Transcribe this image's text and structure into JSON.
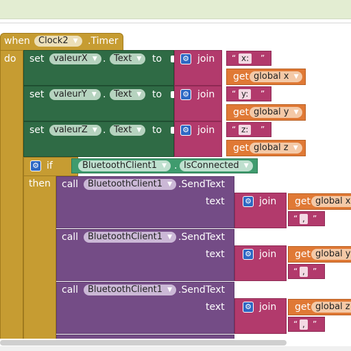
{
  "event": {
    "when": "when",
    "component": "Clock2",
    "event_name": ".Timer",
    "do": "do"
  },
  "sets": [
    {
      "set": "set",
      "component": "valeurX",
      "property": "Text",
      "to": "to",
      "join": "join",
      "text": "x:",
      "get": "get",
      "variable": "global x"
    },
    {
      "set": "set",
      "component": "valeurY",
      "property": "Text",
      "to": "to",
      "join": "join",
      "text": "y:",
      "get": "get",
      "variable": "global y"
    },
    {
      "set": "set",
      "component": "valeurZ",
      "property": "Text",
      "to": "to",
      "join": "join",
      "text": "z:",
      "get": "get",
      "variable": "global z"
    }
  ],
  "if_block": {
    "if": "if",
    "then": "then",
    "component": "BluetoothClient1",
    "property": "IsConnected"
  },
  "calls": [
    {
      "call": "call",
      "component": "BluetoothClient1",
      "method": ".SendText",
      "text_label": "text",
      "join": "join",
      "get": "get",
      "variable": "global x",
      "string": ","
    },
    {
      "call": "call",
      "component": "BluetoothClient1",
      "method": ".SendText",
      "text_label": "text",
      "join": "join",
      "get": "get",
      "variable": "global y",
      "string": ","
    },
    {
      "call": "call",
      "component": "BluetoothClient1",
      "method": ".SendText",
      "text_label": "text",
      "join": "join",
      "get": "get",
      "variable": "global z",
      "string": ","
    }
  ],
  "quote_open": "“",
  "quote_close": "”",
  "arrow": "▼",
  "gear": "⚙",
  "colors": {
    "event": "#c69c32",
    "set": "#2f6b45",
    "text_join": "#b23a6c",
    "variable_get": "#e07935",
    "component_call": "#744c86",
    "bluetooth_property": "#3f9b6e",
    "mutator": "#2d68c4"
  }
}
